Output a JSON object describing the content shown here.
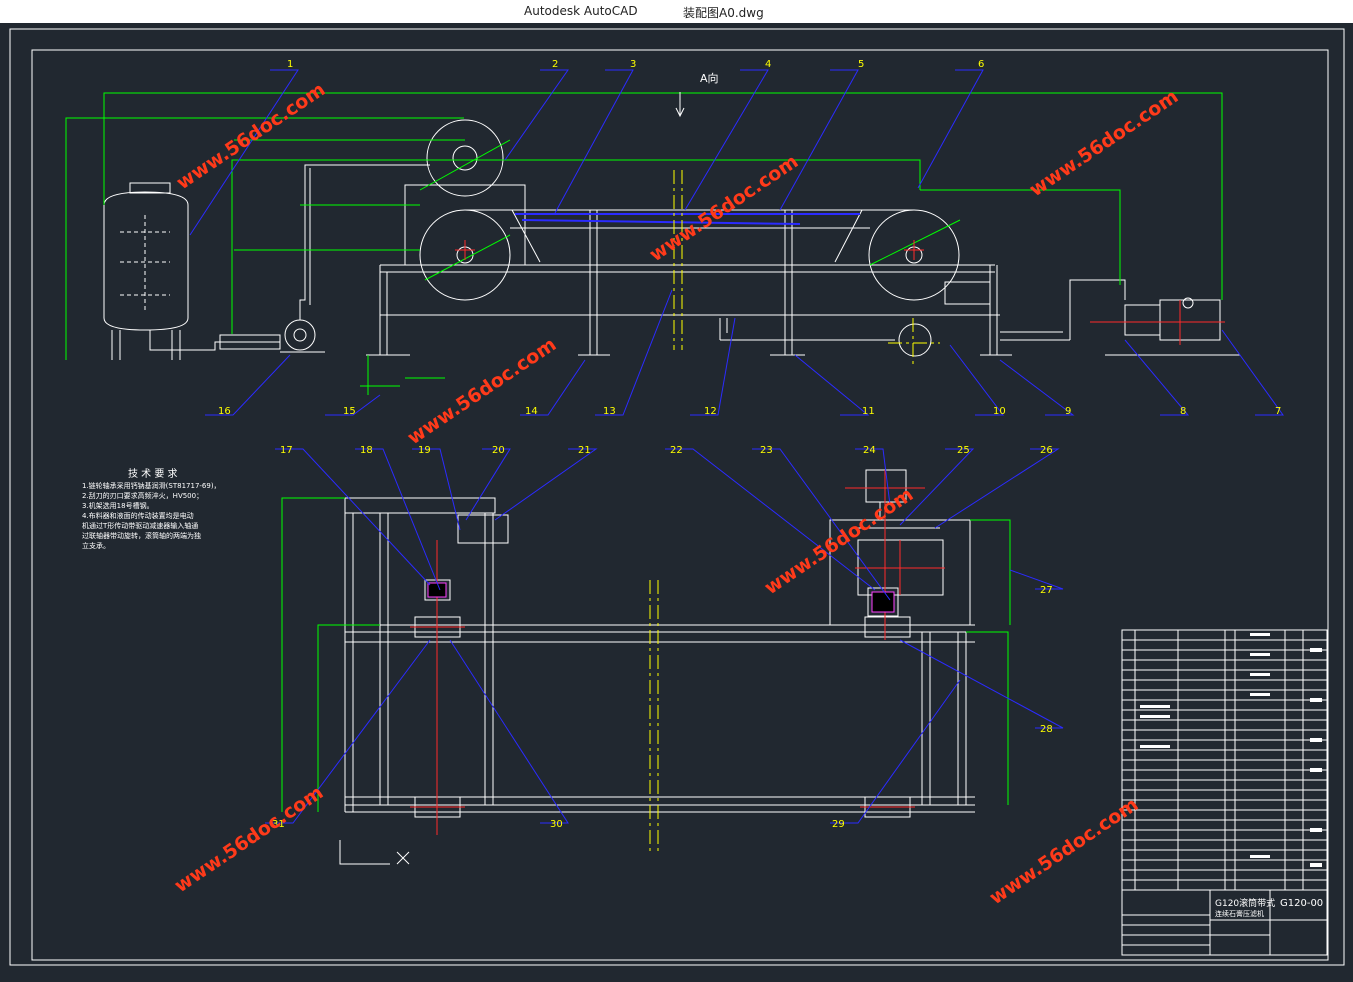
{
  "window": {
    "app_name": "Autodesk AutoCAD",
    "file_name": "装配图A0.dwg"
  },
  "watermark": "www.56doc.com",
  "view_label": "A向",
  "callouts_top": [
    "1",
    "2",
    "3",
    "4",
    "5",
    "6",
    "7",
    "8",
    "9",
    "10",
    "11",
    "12",
    "13",
    "14",
    "15",
    "16"
  ],
  "callouts_bottom": [
    "17",
    "18",
    "19",
    "20",
    "21",
    "22",
    "23",
    "24",
    "25",
    "26",
    "27",
    "28",
    "29",
    "30",
    "31"
  ],
  "tech_req": {
    "title": "技 术 要 求",
    "lines": [
      "1.链轮轴承采用钙钠基润滑(ST81717-69)，",
      "2.刮刀的刃口要求高频淬火，HV500；",
      "3.机架选用18号槽钢。",
      "4.布料器和液面的传动装置均是电动",
      "机通过T形传动带驱动减速器输入轴通",
      "过联轴器带动旋转，滚筒轴的两端为独",
      "立支承。"
    ]
  },
  "title_block": {
    "product": "G120滚筒带式",
    "product_sub": "连续石膏压滤机",
    "drawing_no": "G120-00"
  },
  "colors": {
    "background": "#212830",
    "line": "#ffffff",
    "dim": "#00ff00",
    "leader": "#2b2bff",
    "center": "#ff2a2a",
    "accent": "#ffff00",
    "watermark": "#ff3a1a"
  }
}
